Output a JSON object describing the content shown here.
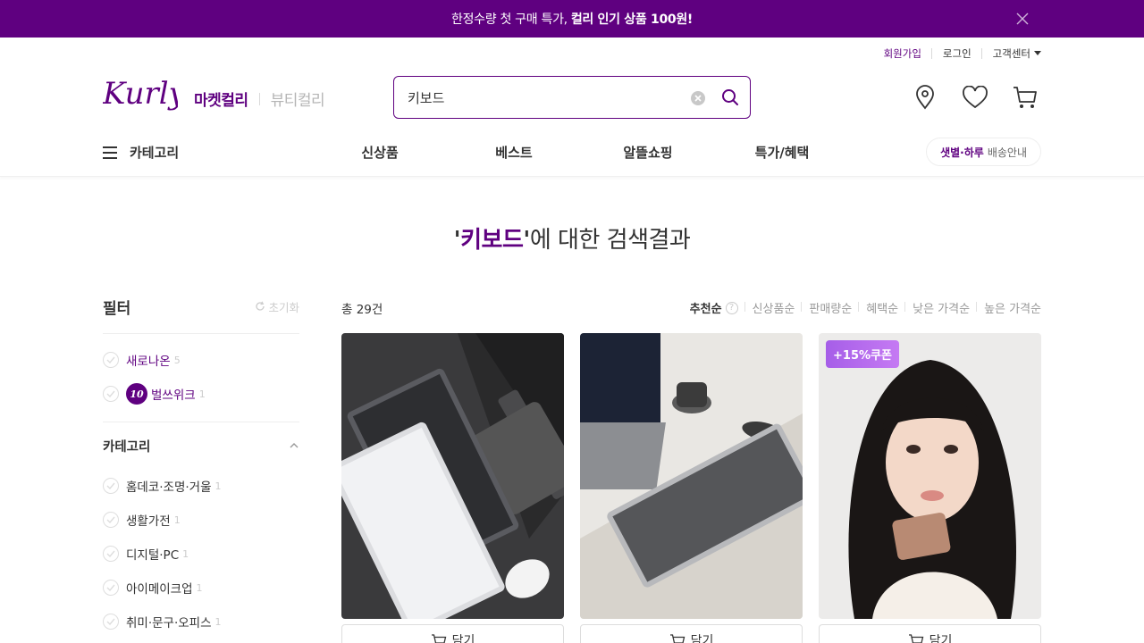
{
  "banner": {
    "text": "한정수량 첫 구매 특가,",
    "highlight": "컬리 인기 상품 100원!"
  },
  "util": {
    "join": "회원가입",
    "login": "로그인",
    "cs": "고객센터"
  },
  "brand": {
    "logo_text": "Kurly",
    "market": "마켓컬리",
    "beauty": "뷰티컬리"
  },
  "search": {
    "value": "키보드"
  },
  "nav": {
    "category": "카테고리",
    "items": [
      "신상품",
      "베스트",
      "알뜰쇼핑",
      "특가/혜택"
    ],
    "delivery_bold": "샛별·하루",
    "delivery_text": "배송안내"
  },
  "result": {
    "quote_open": "'",
    "keyword": "키보드",
    "quote_close": "'",
    "suffix": "에 대한 검색결과"
  },
  "filter": {
    "title": "필터",
    "reset": "초기화",
    "flags": [
      {
        "label": "새로나온",
        "count": "5"
      },
      {
        "label": "벌쓰위크",
        "count": "1",
        "badge": "10"
      }
    ],
    "category_title": "카테고리",
    "categories": [
      {
        "label": "홈데코·조명·거울",
        "count": "1"
      },
      {
        "label": "생활가전",
        "count": "1"
      },
      {
        "label": "디지털·PC",
        "count": "1"
      },
      {
        "label": "아이메이크업",
        "count": "1"
      },
      {
        "label": "취미·문구·오피스",
        "count": "1"
      }
    ]
  },
  "toolbar": {
    "total": "총 29건",
    "sort": [
      "추천순",
      "신상품순",
      "판매량순",
      "혜택순",
      "낮은 가격순",
      "높은 가격순"
    ],
    "help": "?"
  },
  "products": [
    {
      "coupon": "",
      "cart_label": "담기"
    },
    {
      "coupon": "",
      "cart_label": "담기"
    },
    {
      "coupon": "+15%쿠폰",
      "cart_label": "담기"
    }
  ],
  "colors": {
    "brand": "#5f0080",
    "coupon": "#b86df0"
  }
}
